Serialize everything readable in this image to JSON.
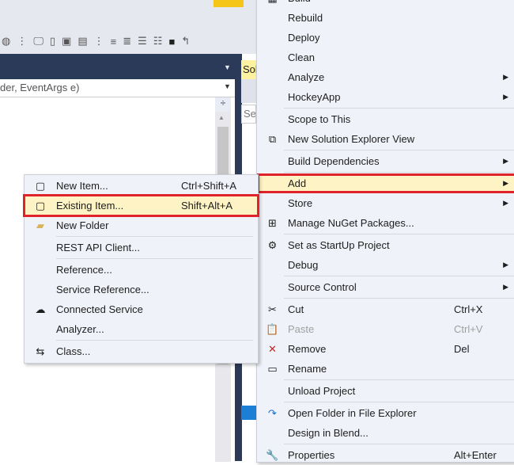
{
  "editor": {
    "method_combo": "der, EventArgs e)",
    "split_icon": "÷"
  },
  "solution_explorer": {
    "tab_label": "Solution Explorer",
    "search_placeholder": "Search"
  },
  "context_menu": {
    "items": [
      {
        "type": "item",
        "label": "Build",
        "icon": "build-icon"
      },
      {
        "type": "item",
        "label": "Rebuild"
      },
      {
        "type": "item",
        "label": "Deploy"
      },
      {
        "type": "item",
        "label": "Clean"
      },
      {
        "type": "item",
        "label": "Analyze",
        "submenu": true
      },
      {
        "type": "item",
        "label": "HockeyApp",
        "submenu": true
      },
      {
        "type": "sep"
      },
      {
        "type": "item",
        "label": "Scope to This"
      },
      {
        "type": "item",
        "label": "New Solution Explorer View",
        "icon": "new-view-icon"
      },
      {
        "type": "sep"
      },
      {
        "type": "item",
        "label": "Build Dependencies",
        "submenu": true
      },
      {
        "type": "sep"
      },
      {
        "type": "item",
        "label": "Add",
        "submenu": true,
        "highlighted": true
      },
      {
        "type": "item",
        "label": "Store",
        "submenu": true
      },
      {
        "type": "item",
        "label": "Manage NuGet Packages...",
        "icon": "nuget-icon"
      },
      {
        "type": "sep"
      },
      {
        "type": "item",
        "label": "Set as StartUp Project",
        "icon": "gear-icon"
      },
      {
        "type": "item",
        "label": "Debug",
        "submenu": true
      },
      {
        "type": "sep"
      },
      {
        "type": "item",
        "label": "Source Control",
        "submenu": true
      },
      {
        "type": "sep"
      },
      {
        "type": "item",
        "label": "Cut",
        "shortcut": "Ctrl+X",
        "icon": "scissors-icon"
      },
      {
        "type": "item",
        "label": "Paste",
        "shortcut": "Ctrl+V",
        "icon": "paste-icon",
        "disabled": true
      },
      {
        "type": "item",
        "label": "Remove",
        "shortcut": "Del",
        "icon": "remove-icon"
      },
      {
        "type": "item",
        "label": "Rename",
        "icon": "rename-icon"
      },
      {
        "type": "sep"
      },
      {
        "type": "item",
        "label": "Unload Project"
      },
      {
        "type": "sep"
      },
      {
        "type": "item",
        "label": "Open Folder in File Explorer",
        "icon": "open-folder-icon"
      },
      {
        "type": "item",
        "label": "Design in Blend..."
      },
      {
        "type": "sep"
      },
      {
        "type": "item",
        "label": "Properties",
        "shortcut": "Alt+Enter",
        "icon": "wrench-icon"
      }
    ]
  },
  "add_submenu": {
    "items": [
      {
        "type": "item",
        "label": "New Item...",
        "shortcut": "Ctrl+Shift+A",
        "icon": "new-item-icon"
      },
      {
        "type": "item",
        "label": "Existing Item...",
        "shortcut": "Shift+Alt+A",
        "icon": "existing-item-icon",
        "highlighted": true
      },
      {
        "type": "item",
        "label": "New Folder",
        "icon": "new-folder-icon"
      },
      {
        "type": "sep"
      },
      {
        "type": "item",
        "label": "REST API Client..."
      },
      {
        "type": "sep"
      },
      {
        "type": "item",
        "label": "Reference..."
      },
      {
        "type": "item",
        "label": "Service Reference..."
      },
      {
        "type": "item",
        "label": "Connected Service",
        "icon": "connected-service-icon"
      },
      {
        "type": "item",
        "label": "Analyzer..."
      },
      {
        "type": "sep"
      },
      {
        "type": "item",
        "label": "Class...",
        "icon": "class-icon"
      }
    ]
  },
  "colors": {
    "highlight": "#fdf3c4",
    "annotation_box": "#e0222a",
    "nav": "#2b3a58"
  }
}
